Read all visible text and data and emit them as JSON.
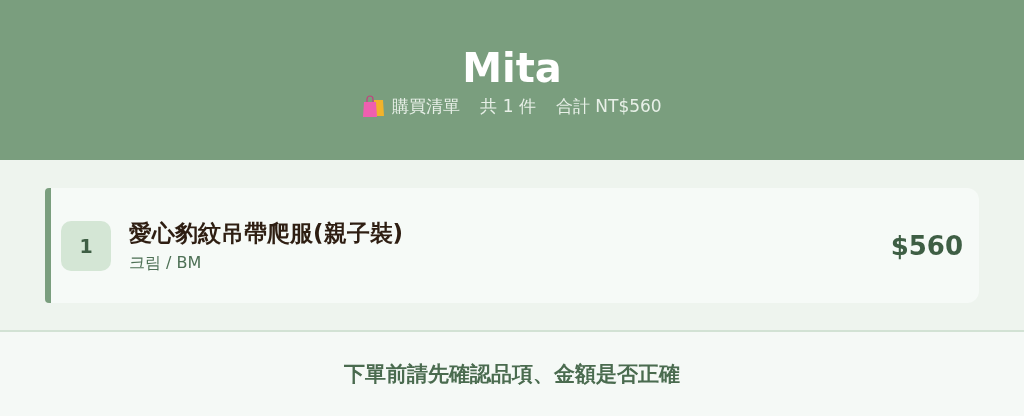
{
  "header": {
    "title": "Mita",
    "list_label": "購買清單",
    "count": "共 1 件",
    "total": "合計 NT$560"
  },
  "items": [
    {
      "index": "1",
      "name": "愛心豹紋吊帶爬服(親子裝)",
      "variant": "크림 / BM",
      "price": "$560"
    }
  ],
  "footer": {
    "note": "下單前請先確認品項、金額是否正確"
  }
}
